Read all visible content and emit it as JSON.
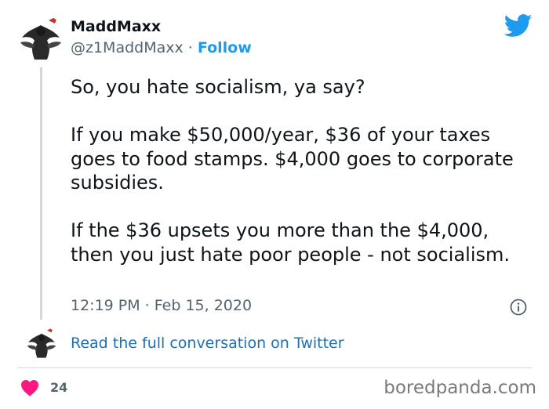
{
  "author": {
    "name": "MaddMaxx",
    "handle": "@z1MaddMaxx",
    "separator": " · ",
    "follow_label": "Follow"
  },
  "tweet": {
    "paragraphs": [
      "So, you hate socialism, ya say?",
      "If you make $50,000/year, $36 of your taxes goes to food stamps. $4,000 goes to corporate subsidies.",
      "If the $36 upsets you more than the $4,000, then you just hate poor people - not socialism."
    ],
    "timestamp": "12:19 PM · Feb 15, 2020"
  },
  "conversation_link": "Read the full conversation on Twitter",
  "likes": {
    "count": "24"
  },
  "watermark": "boredpanda.com",
  "colors": {
    "twitter_blue": "#1d9bf0",
    "heart": "#f91880",
    "muted": "#536471"
  },
  "icons": [
    "twitter-bird-icon",
    "info-icon",
    "heart-icon"
  ]
}
